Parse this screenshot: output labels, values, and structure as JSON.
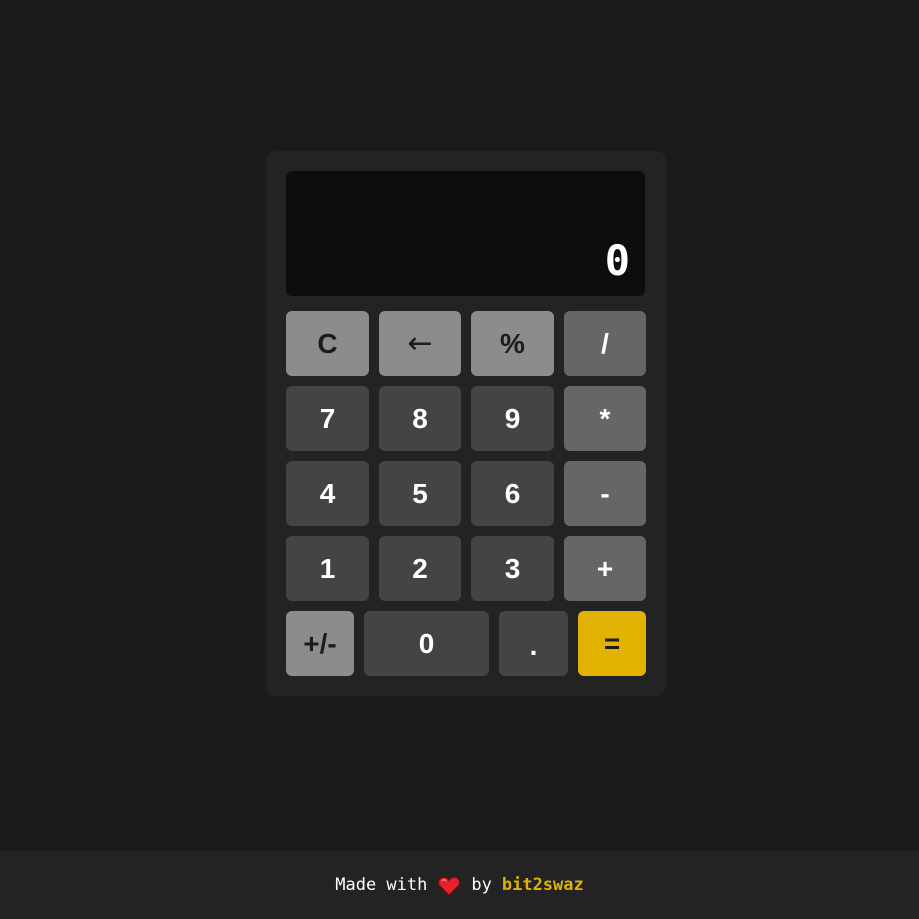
{
  "display": {
    "value": "0"
  },
  "keys": {
    "clear": "C",
    "backspace": "←",
    "percent": "%",
    "divide": "/",
    "seven": "7",
    "eight": "8",
    "nine": "9",
    "multiply": "*",
    "four": "4",
    "five": "5",
    "six": "6",
    "subtract": "-",
    "one": "1",
    "two": "2",
    "three": "3",
    "add": "+",
    "negate": "+/-",
    "zero": "0",
    "decimal": ".",
    "equals": "="
  },
  "footer": {
    "made_with": "Made with",
    "by": "by",
    "author": "bit2swaz",
    "heart_icon": "heart-icon"
  },
  "colors": {
    "background": "#1b1b1b",
    "calculator": "#232323",
    "display": "#0d0d0d",
    "function_key": "#8c8c8c",
    "operator_key": "#666666",
    "number_key": "#444444",
    "accent": "#e2b203",
    "heart": "#e8202e"
  }
}
